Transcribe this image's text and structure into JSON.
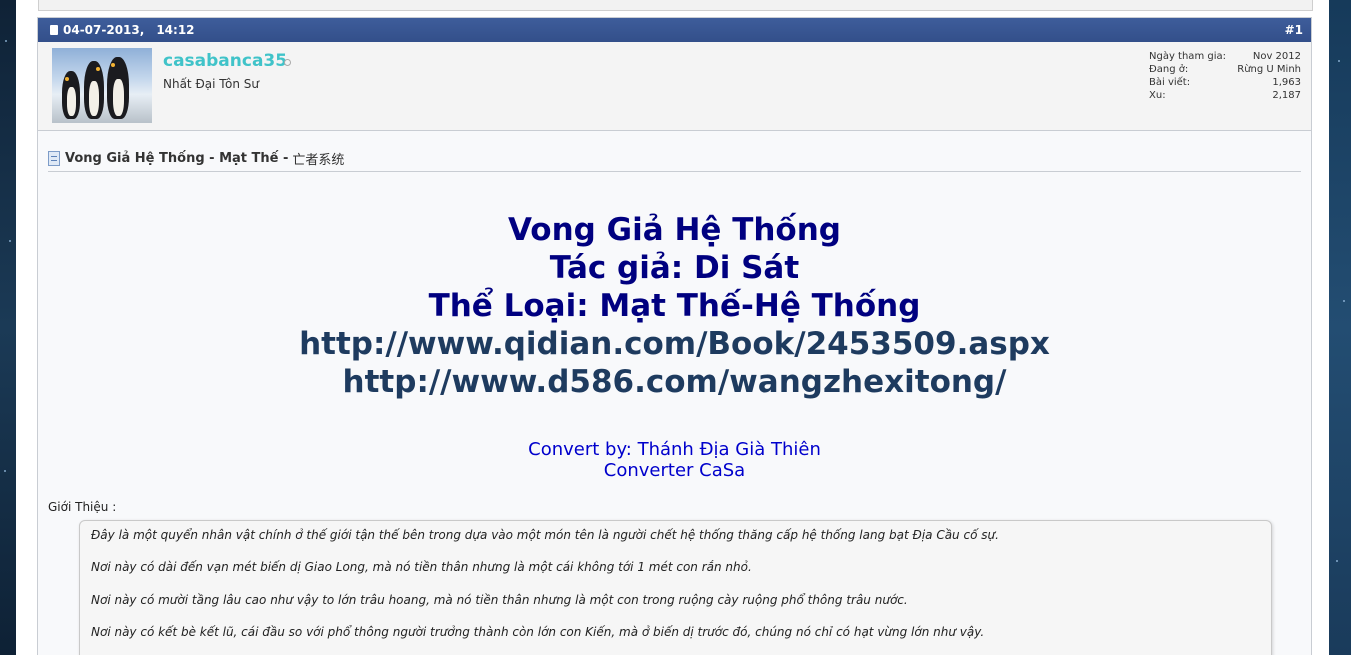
{
  "post": {
    "date": "04-07-2013,",
    "time": "14:12",
    "number": "#1"
  },
  "user": {
    "name": "casabanca35",
    "title": "Nhất Đại Tôn Sư",
    "stats": [
      {
        "label": "Ngày tham gia:",
        "value": "Nov 2012"
      },
      {
        "label": "Đang ở:",
        "value": "Rừng U Minh"
      },
      {
        "label": "Bài viết:",
        "value": "1,963"
      },
      {
        "label": "Xu:",
        "value": "2,187"
      }
    ]
  },
  "thread": {
    "title_bold": "Vong Giả Hệ Thống - Mạt Thế -",
    "title_cn": "亡者系统"
  },
  "content": {
    "heading_lines": [
      "Vong Giả Hệ Thống",
      "Tác giả: Di Sát",
      "Thể Loại: Mạt Thế-Hệ Thống"
    ],
    "urls": [
      "http://www.qidian.com/Book/2453509.aspx",
      "http://www.d586.com/wangzhexitong/"
    ],
    "convert_by": "Convert by: Thánh Địa Già Thiên",
    "converter": "Converter CaSa",
    "intro_label": "Giới Thiệu :",
    "quote_lines": [
      "Đây là một quyển nhân vật chính ở thế giới tận thế bên trong dựa vào một món tên là người chết hệ thống thăng cấp hệ thống lang bạt Địa Cầu cố sự.",
      "Nơi này có dài đến vạn mét biến dị Giao Long, mà nó tiền thân nhưng là một cái không tới 1 mét con rắn nhỏ.",
      "Nơi này có mười tầng lâu cao như vậy to lớn trâu hoang, mà nó tiền thân nhưng là một con trong ruộng cày ruộng phổ thông trâu nước.",
      "Nơi này có kết bè kết lũ, cái đầu so với phổ thông người trưởng thành còn lớn con Kiến, mà ở biến dị trước đó, chúng nó chỉ có hạt vừng lớn như vậy."
    ]
  },
  "colors": {
    "header_bar": "#3b5998",
    "username": "#40c3c9",
    "heading": "#000080",
    "url": "#1e3b5f",
    "convert": "#0000cc"
  }
}
